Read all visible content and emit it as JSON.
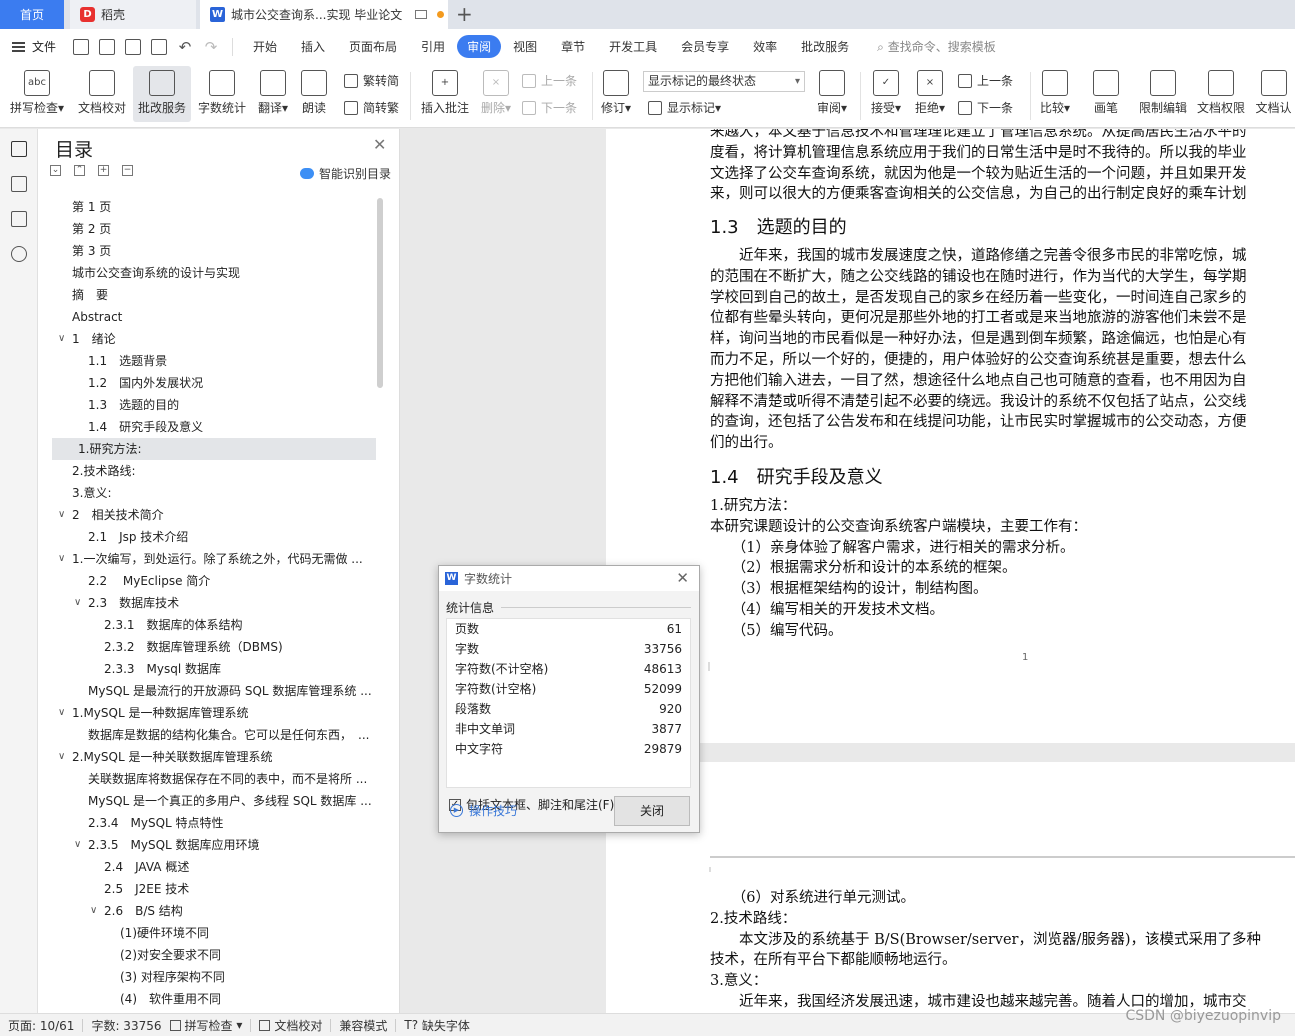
{
  "tabs": {
    "home": "首页",
    "daoke": "稻壳",
    "doc_title": "城市公交查询系...实现 毕业论文"
  },
  "menu": {
    "file": "文件",
    "items": [
      "开始",
      "插入",
      "页面布局",
      "引用",
      "审阅",
      "视图",
      "章节",
      "开发工具",
      "会员专享",
      "效率",
      "批改服务"
    ],
    "active": "审阅",
    "search": "查找命令、搜索模板"
  },
  "ribbon": {
    "spell": "拼写检查",
    "doc_check": "文档校对",
    "correction": "批改服务",
    "word_count": "字数统计",
    "translate": "翻译",
    "read_aloud": "朗读",
    "to_traditional": "繁转简",
    "to_simplified": "简转繁",
    "insert_comment": "插入批注",
    "delete": "删除",
    "prev_comment": "上一条",
    "next_comment": "下一条",
    "track": "修订",
    "markup_state": "显示标记的最终状态",
    "show_markup": "显示标记",
    "review": "审阅",
    "accept": "接受",
    "reject": "拒绝",
    "prev_change": "上一条",
    "next_change": "下一条",
    "compare": "比较",
    "ink": "画笔",
    "restrict": "限制编辑",
    "permission": "文档权限",
    "doc_more": "文档认"
  },
  "toc": {
    "title": "目录",
    "ai_label": "智能识别目录",
    "items": [
      {
        "text": "第 1 页",
        "level": 1
      },
      {
        "text": "第 2 页",
        "level": 1
      },
      {
        "text": "第 3 页",
        "level": 1
      },
      {
        "text": "城市公交查询系统的设计与实现",
        "level": 1
      },
      {
        "text": "摘　要",
        "level": 1
      },
      {
        "text": "Abstract",
        "level": 1
      },
      {
        "text": "1　绪论",
        "level": 1,
        "arrow": true
      },
      {
        "text": "1.1　选题背景",
        "level": 2
      },
      {
        "text": "1.2　国内外发展状况",
        "level": 2
      },
      {
        "text": "1.3　选题的目的",
        "level": 2
      },
      {
        "text": "1.4　研究手段及意义",
        "level": 2
      },
      {
        "text": "1.研究方法:",
        "level": 1,
        "selected": true
      },
      {
        "text": "2.技术路线:",
        "level": 1
      },
      {
        "text": "3.意义:",
        "level": 1
      },
      {
        "text": "2　相关技术简介",
        "level": 1,
        "arrow": true
      },
      {
        "text": "2.1　Jsp 技术介绍",
        "level": 2
      },
      {
        "text": "1.一次编写，到处运行。除了系统之外，代码无需做 ...",
        "level": 1,
        "arrow": true
      },
      {
        "text": "2.2　 MyEclipse 简介",
        "level": 2
      },
      {
        "text": "2.3　数据库技术",
        "level": 2,
        "arrow": true
      },
      {
        "text": "2.3.1　数据库的体系结构",
        "level": 3
      },
      {
        "text": "2.3.2　数据库管理系统（DBMS)",
        "level": 3
      },
      {
        "text": "2.3.3　Mysql 数据库",
        "level": 3
      },
      {
        "text": "MySQL 是最流行的开放源码 SQL 数据库管理系统 ...",
        "level": 2
      },
      {
        "text": "1.MySQL 是一种数据库管理系统",
        "level": 1,
        "arrow": true
      },
      {
        "text": "数据库是数据的结构化集合。它可以是任何东西，　...",
        "level": 2
      },
      {
        "text": "2.MySQL 是一种关联数据库管理系统",
        "level": 1,
        "arrow": true
      },
      {
        "text": "关联数据库将数据保存在不同的表中，而不是将所 ...",
        "level": 2
      },
      {
        "text": "MySQL 是一个真正的多用户、多线程 SQL 数据库 ...",
        "level": 2
      },
      {
        "text": "2.3.4　MySQL 特点特性",
        "level": 2
      },
      {
        "text": "2.3.5　MySQL 数据库应用环境",
        "level": 2,
        "arrow": true
      },
      {
        "text": "2.4　JAVA 概述",
        "level": 3
      },
      {
        "text": "2.5　J2EE 技术",
        "level": 3
      },
      {
        "text": "2.6　B/S 结构",
        "level": 3,
        "arrow": true
      },
      {
        "text": "(1)硬件环境不同",
        "level": 4
      },
      {
        "text": "(2)对安全要求不同",
        "level": 4
      },
      {
        "text": "(3) 对程序架构不同",
        "level": 4
      },
      {
        "text": "(4)　软件重用不同",
        "level": 4
      }
    ]
  },
  "document": {
    "page1": {
      "lines_top": [
        "来越大，本文基于信息技术和管理理论建立了管理信息系统。从提高居民生活水平的",
        "度看，将计算机管理信息系统应用于我们的日常生活中是时不我待的。所以我的毕业",
        "文选择了公交车查询系统，就因为他是一个较为贴近生活的一个问题，并且如果开发",
        "来，则可以很大的方便乘客查询相关的公交信息，为自己的出行制定良好的乘车计划"
      ],
      "heading_13": "1.3　选题的目的",
      "lines_13": [
        "　　近年来，我国的城市发展速度之快，道路修缮之完善令很多市民的非常吃惊，城",
        "的范围在不断扩大，随之公交线路的铺设也在随时进行，作为当代的大学生，每学期",
        "学校回到自己的故土，是否发现自己的家乡在经历着一些变化，一时间连自己家乡的",
        "位都有些晕头转向，更何况是那些外地的打工者或是来当地旅游的游客他们未尝不是",
        "样，询问当地的市民看似是一种好办法，但是遇到倒车频繁，路途偏远，也怕是心有",
        "而力不足，所以一个好的，便捷的，用户体验好的公交查询系统甚是重要，想去什么",
        "方把他们输入进去，一目了然，想途径什么地点自己也可随意的查看，也不用因为自",
        "解释不清楚或听得不清楚引起不必要的绕远。我设计的系统不仅包括了站点，公交线",
        "的查询，还包括了公告发布和在线提问功能，让市民实时掌握城市的公交动态，方便",
        "们的出行。"
      ],
      "heading_14": "1.4　研究手段及意义",
      "lines_14": [
        "1.研究方法：",
        "本研究课题设计的公交查询系统客户端模块，主要工作有：",
        "　　（1）亲身体验了解客户需求，进行相关的需求分析。",
        "　　（2）根据需求分析和设计的本系统的框架。",
        "　　（3）根据框架结构的设计，制结构图。",
        "　　（4）编写相关的开发技术文档。",
        "　　（5）编写代码。"
      ],
      "page_number": "1"
    },
    "page2": {
      "lines": [
        "　　（6）对系统进行单元测试。",
        "2.技术路线：",
        "　　本文涉及的系统基于 B/S(Browser/server，浏览器/服务器)，该模式采用了多种",
        "技术，在所有平台下都能顺畅地运行。",
        "3.意义：",
        "　　近年来，我国经济发展迅速，城市建设也越来越完善。随着人口的增加，城市交"
      ]
    }
  },
  "word_count_dialog": {
    "title": "字数统计",
    "section": "统计信息",
    "rows": [
      {
        "label": "页数",
        "value": "61"
      },
      {
        "label": "字数",
        "value": "33756"
      },
      {
        "label": "字符数(不计空格)",
        "value": "48613"
      },
      {
        "label": "字符数(计空格)",
        "value": "52099"
      },
      {
        "label": "段落数",
        "value": "920"
      },
      {
        "label": "非中文单词",
        "value": "3877"
      },
      {
        "label": "中文字符",
        "value": "29879"
      }
    ],
    "include_label": "包括文本框、脚注和尾注(F)",
    "include_checked": true,
    "tips": "操作技巧",
    "close": "关闭"
  },
  "status": {
    "page": "页面: 10/61",
    "words": "字数: 33756",
    "spell": "拼写检查",
    "doc_check": "文档校对",
    "compat": "兼容模式",
    "missing_font": "缺失字体"
  },
  "watermark": "CSDN @biyezuopinvip"
}
